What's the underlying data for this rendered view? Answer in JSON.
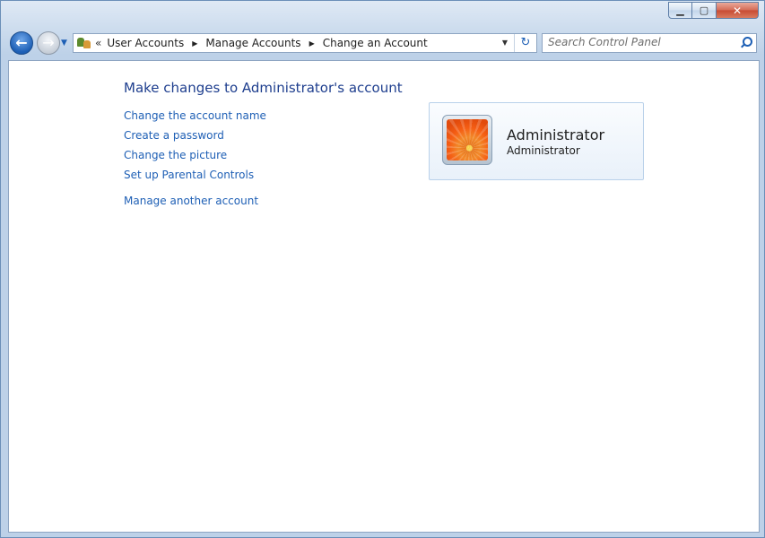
{
  "window": {
    "caption": {
      "minimize": "▁",
      "maximize": "▢",
      "close": "✕"
    }
  },
  "nav": {
    "back_glyph": "←",
    "forward_glyph": "→",
    "recent_glyph": "▼"
  },
  "address": {
    "overflow": "«",
    "breadcrumbs": [
      "User Accounts",
      "Manage Accounts",
      "Change an Account"
    ],
    "separator_glyph": "▶",
    "dropdown_glyph": "▼",
    "refresh_glyph": "↻",
    "icon": "user-accounts-icon"
  },
  "search": {
    "placeholder": "Search Control Panel",
    "icon": "search-icon"
  },
  "main": {
    "title": "Make changes to Administrator's account",
    "links": [
      "Change the account name",
      "Create a password",
      "Change the picture",
      "Set up Parental Controls"
    ],
    "manage_other": "Manage another account"
  },
  "account": {
    "name": "Administrator",
    "type": "Administrator",
    "picture": "flower-avatar"
  },
  "colors": {
    "link": "#1e5fb5",
    "title": "#1e3e8e",
    "accent": "#1d5fb5"
  }
}
